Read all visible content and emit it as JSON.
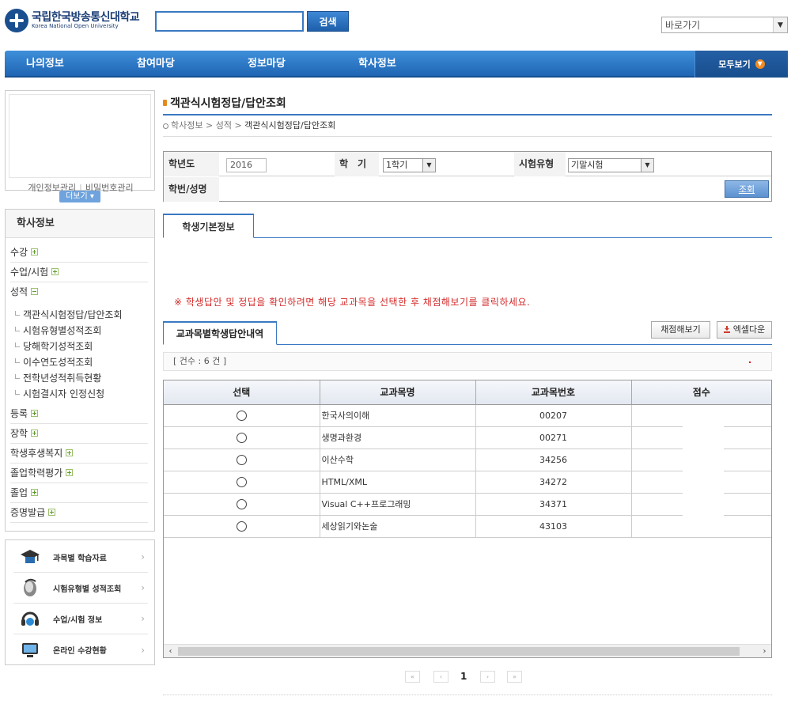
{
  "header": {
    "logo_ko": "국립한국방송통신대학교",
    "logo_en": "Korea National Open University",
    "search_value": "",
    "search_button": "검색",
    "shortcut_select": "바로가기"
  },
  "gnb": {
    "items": [
      "나의정보",
      "참여마당",
      "정보마당",
      "학사정보"
    ],
    "view_all": "모두보기"
  },
  "profile": {
    "link_personal": "개인정보관리",
    "link_password": "비밀번호관리",
    "more": "더보기"
  },
  "lnb": {
    "title": "학사정보",
    "items": [
      {
        "label": "수강",
        "state": "plus"
      },
      {
        "label": "수업/시험",
        "state": "plus"
      },
      {
        "label": "성적",
        "state": "minus"
      },
      {
        "label": "등록",
        "state": "plus"
      },
      {
        "label": "장학",
        "state": "plus"
      },
      {
        "label": "학생후생복지",
        "state": "plus"
      },
      {
        "label": "졸업학력평가",
        "state": "plus"
      },
      {
        "label": "졸업",
        "state": "plus"
      },
      {
        "label": "증명발급",
        "state": "plus"
      }
    ],
    "sub_items": [
      "객관식시험정답/답안조회",
      "시험유형별성적조회",
      "당해학기성적조회",
      "이수연도성적조회",
      "전학년성적취득현황",
      "시험결시자 인정신청"
    ]
  },
  "quick": {
    "items": [
      {
        "label": "과목별 학습자료",
        "icon": "graduation-cap-icon"
      },
      {
        "label": "시험유형별 성적조회",
        "icon": "mouse-icon"
      },
      {
        "label": "수업/시험 정보",
        "icon": "headset-icon"
      },
      {
        "label": "온라인 수강현황",
        "icon": "monitor-icon"
      }
    ]
  },
  "content": {
    "page_title": "객관식시험정답/답안조회",
    "breadcrumb": [
      "학사정보",
      "성적",
      "객관식시험정답/답안조회"
    ],
    "form": {
      "year_label": "학년도",
      "year_value": "2016",
      "semester_label": "학　기",
      "semester_value": "1학기",
      "exam_type_label": "시험유형",
      "exam_type_value": "기말시험",
      "student_label": "학번/성명",
      "student_value": "",
      "inquiry_button": "조회"
    },
    "tab_basic": "학생기본정보",
    "notice": "※ 학생답안 및 정답을 확인하려면 해당 교과목을 선택한 후 채점해보기를 클릭하세요.",
    "subtab": "교과목별학생답안내역",
    "grade_button": "채점해보기",
    "excel_button": "엑셀다운",
    "count_text": "[ 건수 : 6 건 ]",
    "table": {
      "headers": [
        "선택",
        "교과목명",
        "교과목번호",
        "점수"
      ],
      "rows": [
        {
          "name": "한국사의이해",
          "code": "00207",
          "score": ""
        },
        {
          "name": "생명과환경",
          "code": "00271",
          "score": ""
        },
        {
          "name": "이산수학",
          "code": "34256",
          "score": ""
        },
        {
          "name": "HTML/XML",
          "code": "34272",
          "score": ""
        },
        {
          "name": "Visual C++프로그래밍",
          "code": "34371",
          "score": ""
        },
        {
          "name": "세상읽기와논술",
          "code": "43103",
          "score": ""
        }
      ]
    },
    "paging": {
      "current": "1"
    }
  },
  "colors": {
    "primary": "#1f65b4",
    "accent": "#e58a1f",
    "notice": "#d42b2b"
  }
}
